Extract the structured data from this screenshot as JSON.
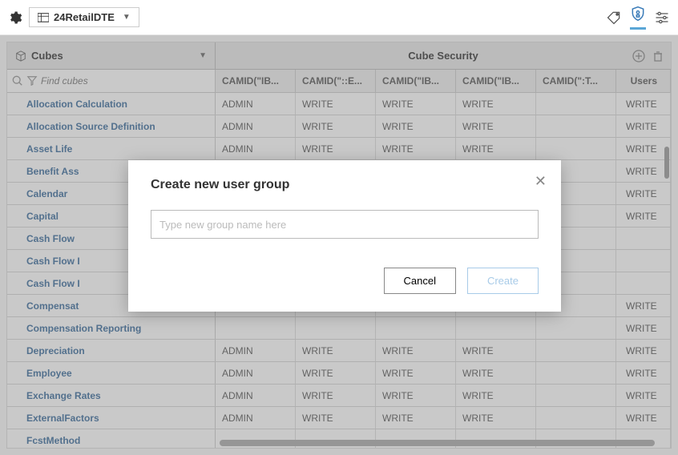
{
  "topbar": {
    "datasource": "24RetailDTE"
  },
  "header": {
    "left_label": "Cubes",
    "center_label": "Cube Security"
  },
  "filter": {
    "placeholder": "Find cubes"
  },
  "columns": {
    "c1": "CAMID(\"IB...",
    "c2": "CAMID(\"::E...",
    "c3": "CAMID(\"IB...",
    "c4": "CAMID(\"IB...",
    "c5": "CAMID(\":T...",
    "users": "Users"
  },
  "rows": [
    {
      "name": "Allocation Calculation",
      "c1": "ADMIN",
      "c2": "WRITE",
      "c3": "WRITE",
      "c4": "WRITE",
      "c5": "",
      "users": "WRITE"
    },
    {
      "name": "Allocation Source Definition",
      "c1": "ADMIN",
      "c2": "WRITE",
      "c3": "WRITE",
      "c4": "WRITE",
      "c5": "",
      "users": "WRITE"
    },
    {
      "name": "Asset Life",
      "c1": "ADMIN",
      "c2": "WRITE",
      "c3": "WRITE",
      "c4": "WRITE",
      "c5": "",
      "users": "WRITE"
    },
    {
      "name": "Benefit Ass",
      "c1": "",
      "c2": "",
      "c3": "",
      "c4": "",
      "c5": "",
      "users": "WRITE"
    },
    {
      "name": "Calendar",
      "c1": "",
      "c2": "",
      "c3": "",
      "c4": "",
      "c5": "",
      "users": "WRITE"
    },
    {
      "name": "Capital",
      "c1": "",
      "c2": "",
      "c3": "",
      "c4": "",
      "c5": "",
      "users": "WRITE"
    },
    {
      "name": "Cash Flow",
      "c1": "",
      "c2": "",
      "c3": "",
      "c4": "",
      "c5": "",
      "users": ""
    },
    {
      "name": "Cash Flow I",
      "c1": "",
      "c2": "",
      "c3": "",
      "c4": "",
      "c5": "",
      "users": ""
    },
    {
      "name": "Cash Flow I",
      "c1": "",
      "c2": "",
      "c3": "",
      "c4": "",
      "c5": "",
      "users": ""
    },
    {
      "name": "Compensat",
      "c1": "",
      "c2": "",
      "c3": "",
      "c4": "",
      "c5": "",
      "users": "WRITE"
    },
    {
      "name": "Compensation Reporting",
      "c1": "",
      "c2": "",
      "c3": "",
      "c4": "",
      "c5": "",
      "users": "WRITE"
    },
    {
      "name": "Depreciation",
      "c1": "ADMIN",
      "c2": "WRITE",
      "c3": "WRITE",
      "c4": "WRITE",
      "c5": "",
      "users": "WRITE"
    },
    {
      "name": "Employee",
      "c1": "ADMIN",
      "c2": "WRITE",
      "c3": "WRITE",
      "c4": "WRITE",
      "c5": "",
      "users": "WRITE"
    },
    {
      "name": "Exchange Rates",
      "c1": "ADMIN",
      "c2": "WRITE",
      "c3": "WRITE",
      "c4": "WRITE",
      "c5": "",
      "users": "WRITE"
    },
    {
      "name": "ExternalFactors",
      "c1": "ADMIN",
      "c2": "WRITE",
      "c3": "WRITE",
      "c4": "WRITE",
      "c5": "",
      "users": "WRITE"
    },
    {
      "name": "FcstMethod",
      "c1": "",
      "c2": "",
      "c3": "",
      "c4": "",
      "c5": "",
      "users": ""
    }
  ],
  "modal": {
    "title": "Create new user group",
    "placeholder": "Type new group name here",
    "cancel": "Cancel",
    "create": "Create"
  }
}
